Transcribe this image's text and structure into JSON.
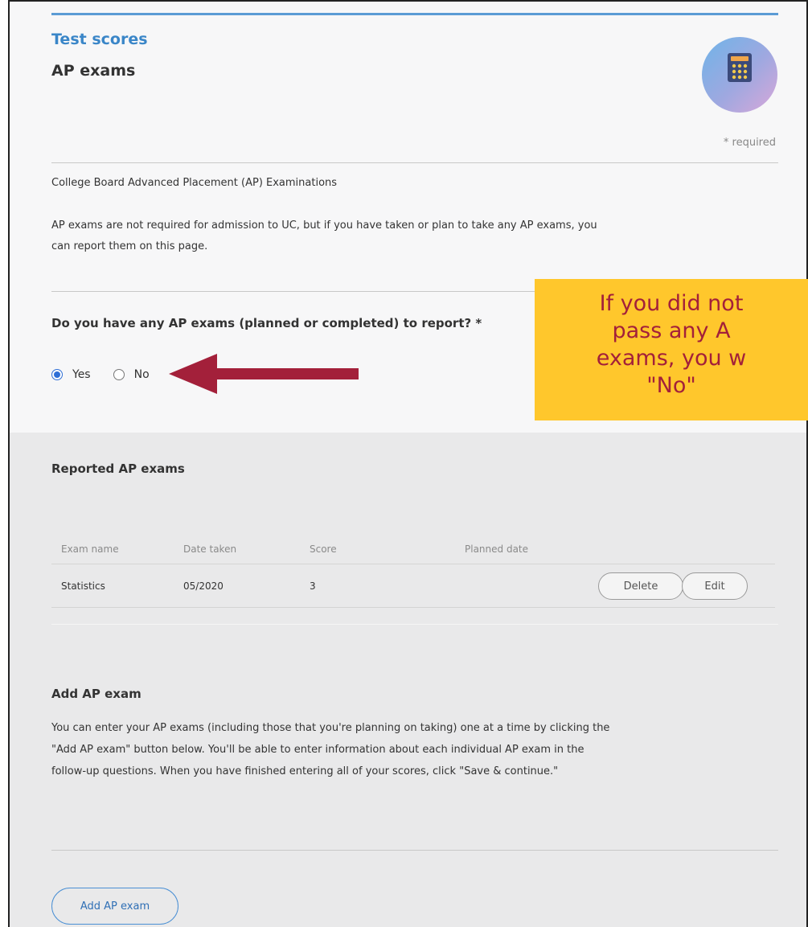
{
  "header": {
    "section": "Test scores",
    "title": "AP exams",
    "avatar_icon": "calculator-icon"
  },
  "required_note": "* required",
  "intro": {
    "heading": "College Board Advanced Placement (AP) Examinations",
    "text": "AP exams are not required for admission to UC, but if you have taken or plan to take any AP exams, you can report them on this page."
  },
  "question": {
    "label": "Do you have any AP exams (planned or completed) to report? *",
    "options": [
      {
        "label": "Yes",
        "selected": true
      },
      {
        "label": "No",
        "selected": false
      }
    ]
  },
  "reported": {
    "heading": "Reported AP exams",
    "columns": [
      "Exam name",
      "Date taken",
      "Score",
      "Planned date"
    ],
    "rows": [
      {
        "exam": "Statistics",
        "date_taken": "05/2020",
        "score": "3",
        "planned_date": ""
      }
    ],
    "delete_label": "Delete",
    "edit_label": "Edit"
  },
  "add_exam": {
    "heading": "Add AP exam",
    "text": "You can enter your AP exams (including those that you're planning on taking) one at a time by clicking the \"Add AP exam\" button below. You'll be able to enter information about each individual AP exam in the follow-up questions. When you have finished entering all of your scores, click \"Save & continue.\"",
    "button_label": "Add AP exam"
  },
  "callout": {
    "lines": [
      "If you did not",
      "pass any A",
      "exams, you w",
      "\"No\""
    ]
  },
  "colors": {
    "accent_blue": "#3a86c8",
    "radio_blue": "#2f6fd6",
    "callout_bg": "#ffc72c",
    "callout_text": "#a3203a",
    "arrow": "#a3203a"
  }
}
